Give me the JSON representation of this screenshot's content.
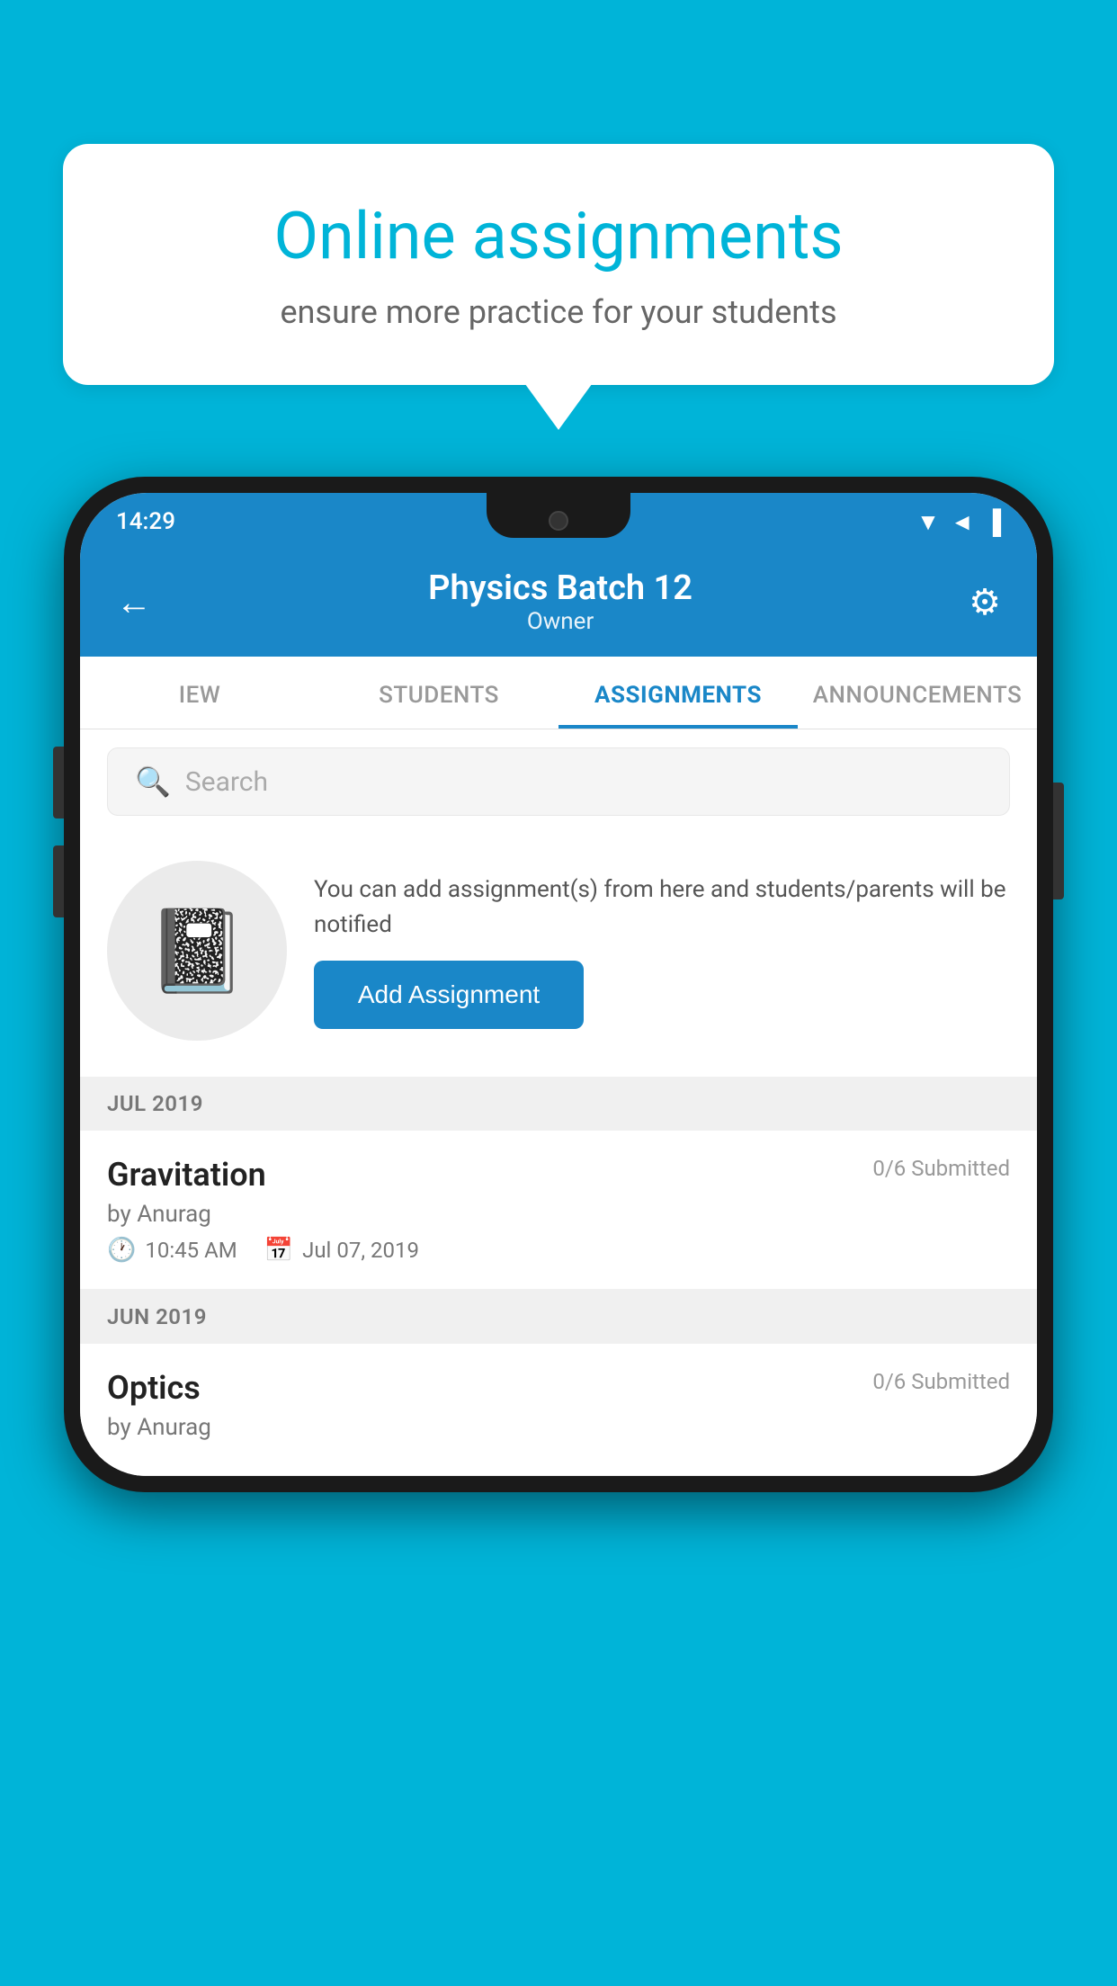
{
  "background_color": "#00b4d8",
  "speech_bubble": {
    "title": "Online assignments",
    "subtitle": "ensure more practice for your students"
  },
  "phone": {
    "status_bar": {
      "time": "14:29",
      "icons": [
        "wifi",
        "signal",
        "battery"
      ]
    },
    "header": {
      "title": "Physics Batch 12",
      "subtitle": "Owner",
      "back_label": "←",
      "settings_label": "⚙"
    },
    "tabs": [
      {
        "label": "IEW",
        "active": false
      },
      {
        "label": "STUDENTS",
        "active": false
      },
      {
        "label": "ASSIGNMENTS",
        "active": true
      },
      {
        "label": "ANNOUNCEMENTS",
        "active": false
      }
    ],
    "search": {
      "placeholder": "Search"
    },
    "promo": {
      "icon": "📓",
      "description": "You can add assignment(s) from here and students/parents will be notified",
      "button_label": "Add Assignment"
    },
    "sections": [
      {
        "month": "JUL 2019",
        "assignments": [
          {
            "title": "Gravitation",
            "submitted": "0/6 Submitted",
            "by": "by Anurag",
            "time": "10:45 AM",
            "date": "Jul 07, 2019"
          }
        ]
      },
      {
        "month": "JUN 2019",
        "assignments": [
          {
            "title": "Optics",
            "submitted": "0/6 Submitted",
            "by": "by Anurag",
            "time": "",
            "date": ""
          }
        ]
      }
    ]
  }
}
